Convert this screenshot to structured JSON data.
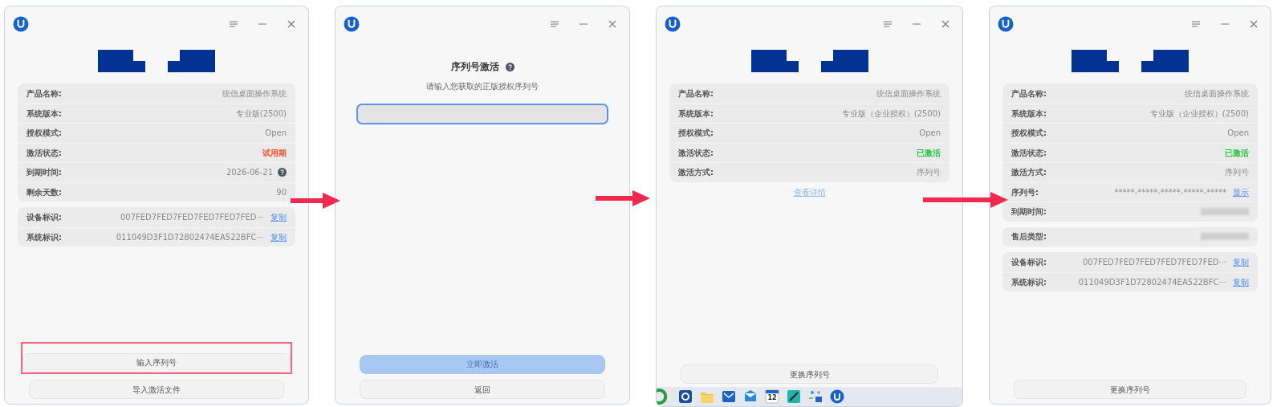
{
  "windows": [
    {
      "kind": "info",
      "groups": [
        {
          "rows": [
            {
              "label": "产品名称:",
              "value": "统信桌面操作系统",
              "kind": "text"
            },
            {
              "label": "系统版本:",
              "value": "专业版(2500)",
              "kind": "text"
            },
            {
              "label": "授权模式:",
              "value": "Open",
              "kind": "text"
            },
            {
              "label": "激活状态:",
              "value": "试用期",
              "kind": "status",
              "color": "#ff4a2a"
            },
            {
              "label": "到期时间:",
              "value": "2026-06-21",
              "kind": "date"
            },
            {
              "label": "剩余天数:",
              "value": "90",
              "kind": "text"
            }
          ]
        },
        {
          "rows": [
            {
              "label": "设备标识:",
              "value": "007FED7FED7FED7FED7FED7FED···",
              "kind": "id",
              "action": "复制"
            },
            {
              "label": "系统标识:",
              "value": "011049D3F1D72802474EA522BFC···",
              "kind": "id",
              "action": "复制"
            }
          ]
        }
      ],
      "buttons": [
        {
          "label": "输入序列号",
          "kind": "default",
          "disabled": false,
          "annotated": true
        },
        {
          "label": "导入激活文件",
          "kind": "default",
          "disabled": false,
          "annotated": false
        }
      ]
    },
    {
      "kind": "serial_entry",
      "heading": "序列号激活",
      "subtitle": "请输入您获取的正版授权序列号",
      "serial_input": {
        "focused": true
      },
      "buttons": [
        {
          "label": "立即激活",
          "kind": "primary",
          "disabled": true,
          "annotated": false
        },
        {
          "label": "返回",
          "kind": "default",
          "disabled": false,
          "annotated": false
        }
      ]
    },
    {
      "kind": "info",
      "groups": [
        {
          "rows": [
            {
              "label": "产品名称:",
              "value": "统信桌面操作系统",
              "kind": "text"
            },
            {
              "label": "系统版本:",
              "value": "专业版（企业授权）(2500)",
              "kind": "text"
            },
            {
              "label": "授权模式:",
              "value": "Open",
              "kind": "text"
            },
            {
              "label": "激活状态:",
              "value": "已激活",
              "kind": "status",
              "color": "#1fc23a"
            },
            {
              "label": "激活方式:",
              "value": "序列号",
              "kind": "text"
            }
          ]
        }
      ],
      "link": "查看详情",
      "buttons": [
        {
          "label": "更换序列号",
          "kind": "default",
          "disabled": false,
          "annotated": false
        }
      ],
      "taskbar": {
        "apps": [
          {
            "kind": "refresh"
          },
          {
            "kind": "settings"
          },
          {
            "kind": "folder"
          },
          {
            "kind": "mail"
          },
          {
            "kind": "mailbox"
          },
          {
            "kind": "calendar",
            "label": "12"
          },
          {
            "kind": "pen"
          },
          {
            "kind": "apps"
          },
          {
            "kind": "uos"
          }
        ]
      }
    },
    {
      "kind": "info",
      "groups": [
        {
          "rows": [
            {
              "label": "产品名称:",
              "value": "统信桌面操作系统",
              "kind": "text"
            },
            {
              "label": "系统版本:",
              "value": "专业版（企业授权）(2500)",
              "kind": "text"
            },
            {
              "label": "授权模式:",
              "value": "Open",
              "kind": "text"
            },
            {
              "label": "激活状态:",
              "value": "已激活",
              "kind": "status",
              "color": "#1fc23a"
            },
            {
              "label": "激活方式:",
              "value": "序列号",
              "kind": "text"
            },
            {
              "label": "序列号:",
              "value": "*****-*****-*****-*****-*****",
              "kind": "id",
              "action": "显示"
            },
            {
              "label": "到期时间:",
              "kind": "blurred"
            }
          ]
        },
        {
          "rows": [
            {
              "label": "售后类型:",
              "kind": "blurred"
            }
          ]
        },
        {
          "rows": [
            {
              "label": "设备标识:",
              "value": "007FED7FED7FED7FED7FED7FED···",
              "kind": "id",
              "action": "复制"
            },
            {
              "label": "系统标识:",
              "value": "011049D3F1D72802474EA522BFC···",
              "kind": "id",
              "action": "复制"
            }
          ]
        }
      ],
      "buttons": [
        {
          "label": "更换序列号",
          "kind": "default",
          "disabled": false,
          "annotated": false
        }
      ]
    }
  ]
}
